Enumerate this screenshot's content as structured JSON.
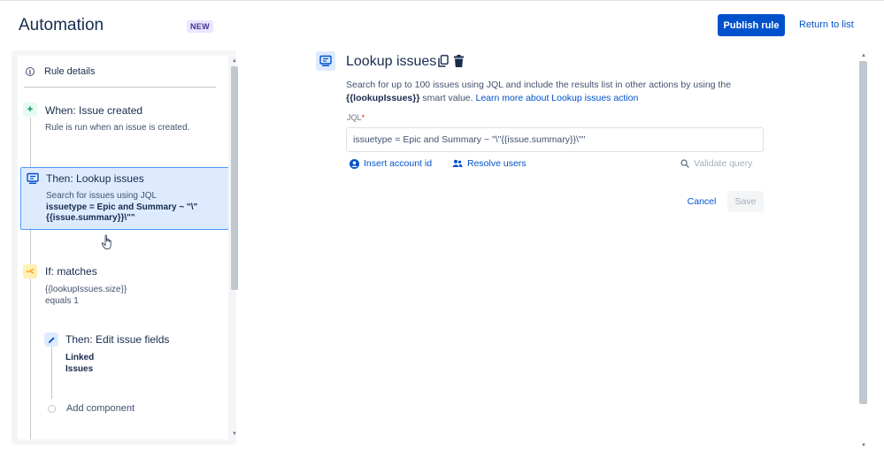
{
  "header": {
    "title": "Automation",
    "badge": "NEW",
    "publish_label": "Publish rule",
    "return_label": "Return to list"
  },
  "sidebar": {
    "rule_details": "Rule details",
    "trigger": {
      "title": "When: Issue created",
      "description": "Rule is run when an issue is created."
    },
    "lookup": {
      "title": "Then: Lookup issues",
      "description": "Search for issues using JQL",
      "query": "issuetype = Epic and Summary ~ \"\\\"{{issue.summary}}\\\"\""
    },
    "condition": {
      "title": "If: matches",
      "description": "{{lookupIssues.size}} equals 1"
    },
    "edit": {
      "title": "Then: Edit issue fields",
      "detail": "Linked Issues"
    },
    "add_component": "Add component"
  },
  "main": {
    "title": "Lookup issues",
    "description_line1": "Search for up to 100 issues using JQL and include the results list in other actions by using the",
    "smart_value": "{{lookupIssues}}",
    "description_mid": " smart value. ",
    "learn_more": "Learn more about Lookup issues action",
    "jql_label": "JQL",
    "required_marker": "*",
    "jql_value": "issuetype = Epic and Summary ~ \"\\\"{{issue.summary}}\\\"\"",
    "insert_account_label": "Insert account id",
    "resolve_users_label": "Resolve users",
    "validate_label": "Validate query",
    "cancel_label": "Cancel",
    "save_label": "Save"
  },
  "icons": {
    "info": "info-icon",
    "trigger": "plus-icon",
    "lookup": "monitor-search-icon",
    "condition": "branch-icon",
    "edit": "pencil-icon",
    "copy": "copy-icon",
    "trash": "trash-icon",
    "account": "user-circle-icon",
    "users": "users-icon",
    "search": "search-icon"
  },
  "colors": {
    "primary": "#0052cc",
    "selected_bg": "#deebff",
    "selected_border": "#4c9aff",
    "trigger_bg": "#e3fcef",
    "condition_bg": "#fff0b3",
    "badge_bg": "#eae6ff"
  }
}
